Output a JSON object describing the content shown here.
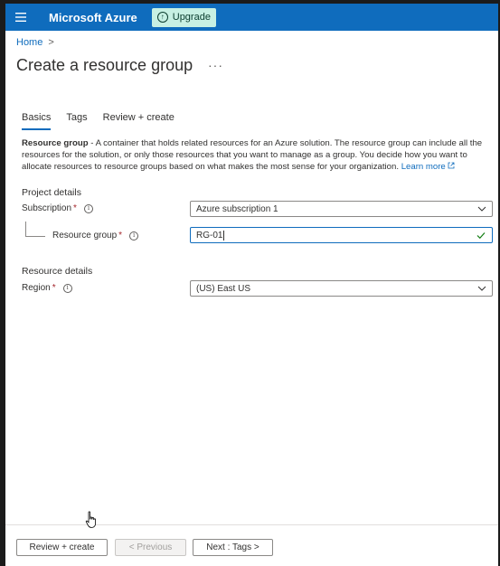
{
  "header": {
    "brand": "Microsoft Azure",
    "upgrade_label": "Upgrade",
    "colors": {
      "bar": "#0f6cbd",
      "upgrade_bg": "#c7f0e3"
    }
  },
  "breadcrumb": {
    "home": "Home",
    "separator": ">"
  },
  "page": {
    "title": "Create a resource group",
    "more": "···"
  },
  "tabs": [
    {
      "label": "Basics",
      "active": true
    },
    {
      "label": "Tags",
      "active": false
    },
    {
      "label": "Review + create",
      "active": false
    }
  ],
  "description": {
    "term": "Resource group",
    "text": " - A container that holds related resources for an Azure solution. The resource group can include all the resources for the solution, or only those resources that you want to manage as a group. You decide how you want to allocate resources to resource groups based on what makes the most sense for your organization. ",
    "learn_more": "Learn more"
  },
  "project_details": {
    "title": "Project details",
    "subscription": {
      "label": "Subscription",
      "required": "*",
      "value": "Azure subscription 1"
    },
    "resource_group": {
      "label": "Resource group",
      "required": "*",
      "value": "RG-01"
    }
  },
  "resource_details": {
    "title": "Resource details",
    "region": {
      "label": "Region",
      "required": "*",
      "value": "(US) East US"
    }
  },
  "footer": {
    "review_create": "Review + create",
    "previous": "< Previous",
    "next": "Next : Tags >"
  },
  "icons": [
    "hamburger-icon",
    "upgrade-arrow-icon",
    "info-icon",
    "chevron-down-icon",
    "checkmark-icon",
    "external-link-icon",
    "hand-cursor-icon"
  ]
}
